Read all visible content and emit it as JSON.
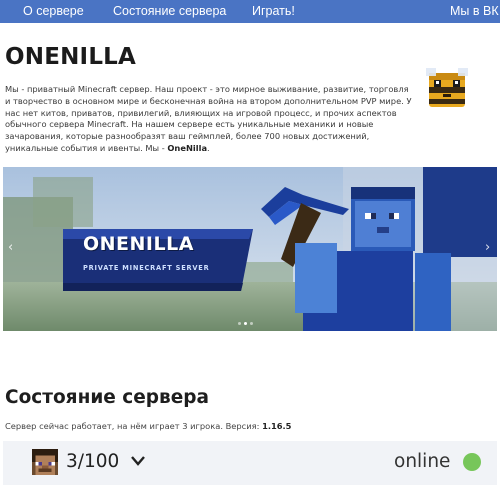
{
  "nav": {
    "about": "О сервере",
    "status": "Состояние сервера",
    "play": "Играть!",
    "vk": "Мы в ВК"
  },
  "header": {
    "title": "ONENILLA",
    "logo_icon": "bee-icon"
  },
  "intro": {
    "text": "Мы - приватный Minecraft сервер. Наш проект - это мирное выживание, развитие, торговля и творчество в основном мире и бесконечная война на втором дополнительном PVP мире. У нас нет китов, приватов, привилегий, влияющих на игровой процесс, и прочих аспектов обычного сервера Minecraft. На нашем сервере есть уникальные механики и новые зачарования, которые разнообразят ваш геймплей, более 700 новых достижений, уникальные события и ивенты. Мы - ",
    "brand": "OneNilla",
    "end": "."
  },
  "carousel": {
    "banner_title": "ONENILLA",
    "banner_subtitle": "PRIVATE MINECRAFT SERVER",
    "prev_icon": "chevron-left-icon",
    "next_icon": "chevron-right-icon",
    "prev_glyph": "‹",
    "next_glyph": "›",
    "slides": 3,
    "active_slide": 2
  },
  "status": {
    "title": "Состояние сервера",
    "text": "Сервер сейчас работает, на нём играет 3 игрока. Версия: ",
    "version": "1.16.5",
    "players": "3/100",
    "online_label": "online",
    "online_color": "#77c65a"
  },
  "colors": {
    "nav_bg": "#4a74c4",
    "accent": "#1a55c8"
  }
}
